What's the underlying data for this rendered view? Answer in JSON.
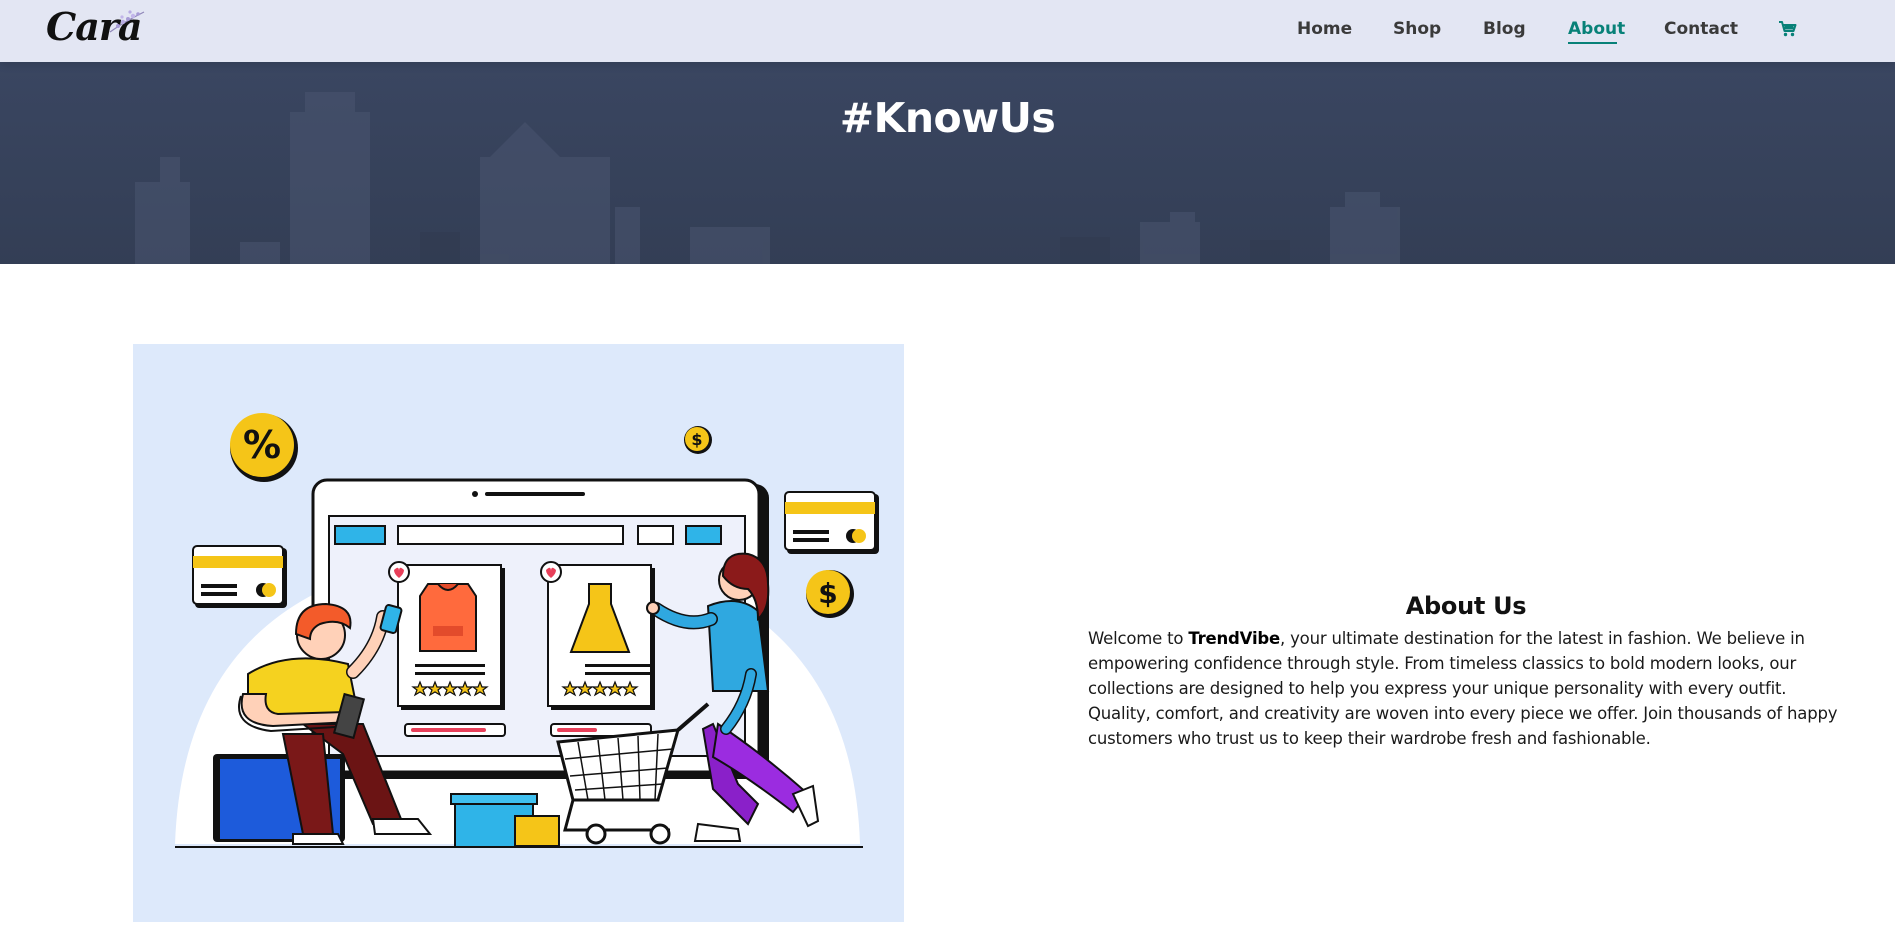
{
  "brand": {
    "name": "Cara"
  },
  "nav": {
    "items": [
      {
        "label": "Home",
        "active": false
      },
      {
        "label": "Shop",
        "active": false
      },
      {
        "label": "Blog",
        "active": false
      },
      {
        "label": "About",
        "active": true
      },
      {
        "label": "Contact",
        "active": false
      }
    ],
    "cart_icon": "cart-icon"
  },
  "hero": {
    "title": "#KnowUs"
  },
  "about": {
    "title": "About Us",
    "intro_before": "Welcome to ",
    "brand_strong": "TrendVibe",
    "intro_after": ", your ultimate destination for the latest in fashion. We believe in empowering confidence through style. From timeless classics to bold modern looks, our collections are designed to help you express your unique personality with every outfit. Quality, comfort, and creativity are woven into every piece we offer. Join thousands of happy customers who trust us to keep their wardrobe fresh and fashionable."
  },
  "colors": {
    "header_bg": "#e3e6f3",
    "accent": "#088178",
    "hero_bg": "#3a4660",
    "panel_bg": "#dde9fb"
  }
}
